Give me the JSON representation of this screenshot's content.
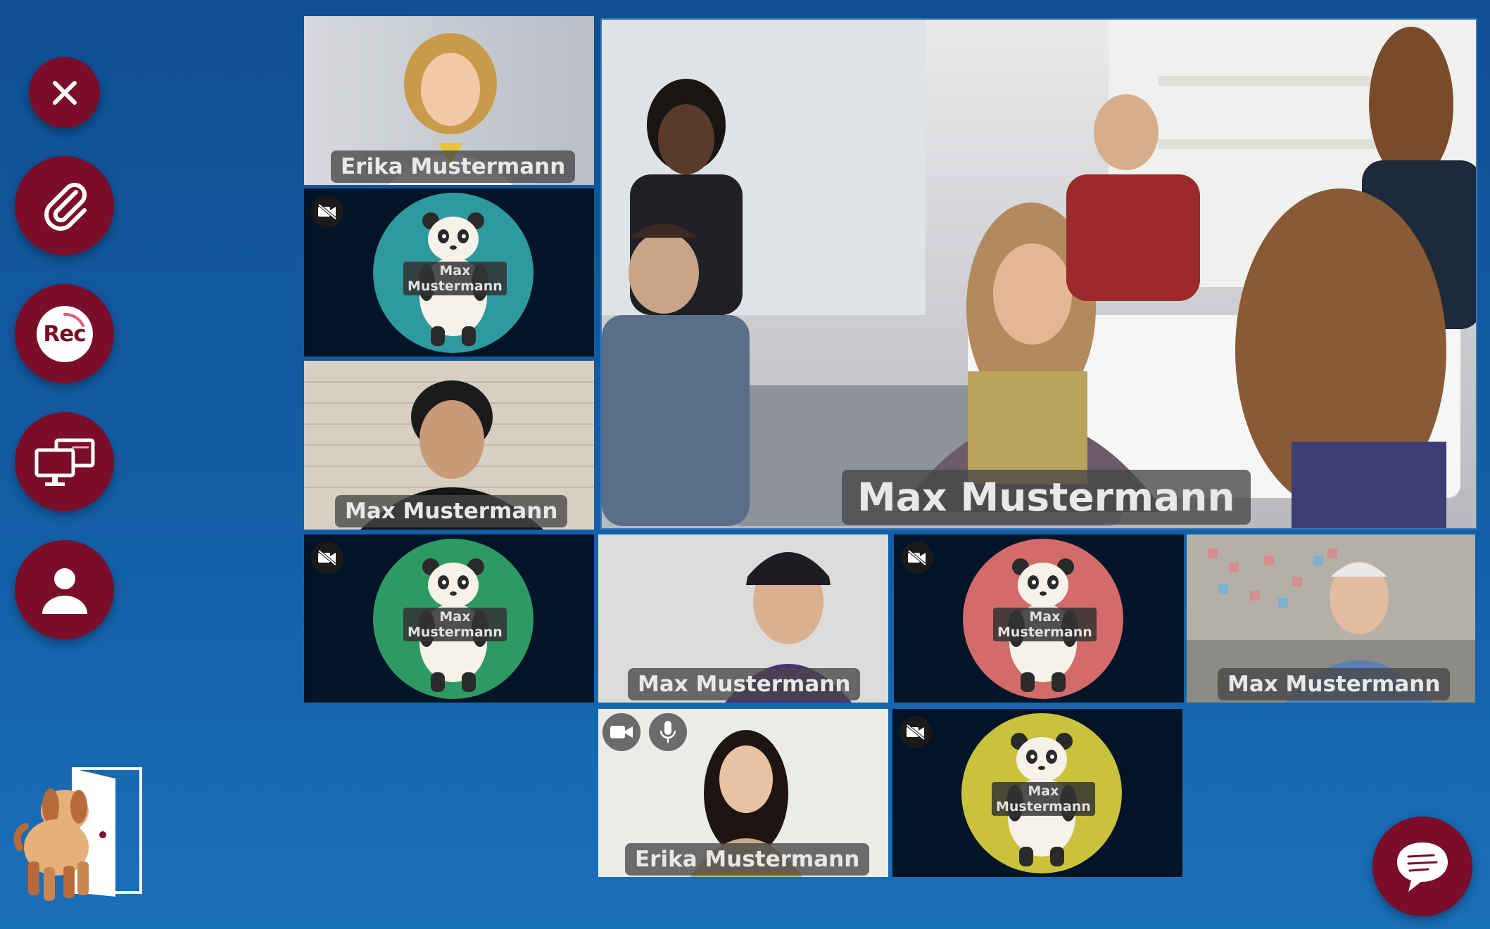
{
  "toolbar": {
    "close_icon": "close-icon",
    "attach_icon": "paperclip-icon",
    "record_label": "Rec",
    "screen_share_icon": "screen-share-icon",
    "profile_icon": "user-icon"
  },
  "exit": {
    "icon": "dog-exit-door-icon"
  },
  "tiles": {
    "t1": {
      "name": "Erika Mustermann",
      "type": "video"
    },
    "t2": {
      "name_line1": "Max",
      "name_line2": "Mustermann",
      "type": "avatar",
      "avatar_color": "#2e9aa0"
    },
    "t3": {
      "name": "Max Mustermann",
      "type": "video"
    },
    "main": {
      "name": "Max Mustermann",
      "type": "video"
    },
    "t4": {
      "name_line1": "Max",
      "name_line2": "Mustermann",
      "type": "avatar",
      "avatar_color": "#2f9964"
    },
    "t5": {
      "name": "Max Mustermann",
      "type": "video"
    },
    "t6": {
      "name_line1": "Max",
      "name_line2": "Mustermann",
      "type": "avatar",
      "avatar_color": "#d36b6b"
    },
    "t7": {
      "name": "Max Mustermann",
      "type": "video"
    },
    "t8": {
      "name": "Erika Mustermann",
      "type": "video",
      "controls": [
        "camera-icon",
        "microphone-icon"
      ]
    },
    "t9": {
      "name_line1": "Max",
      "name_line2": "Mustermann",
      "type": "avatar",
      "avatar_color": "#c9c23a"
    }
  },
  "chat": {
    "icon": "chat-bubble-icon"
  },
  "colors": {
    "background": "#1460a8",
    "accent": "#7a0d2a",
    "tile_dark": "#021528"
  }
}
